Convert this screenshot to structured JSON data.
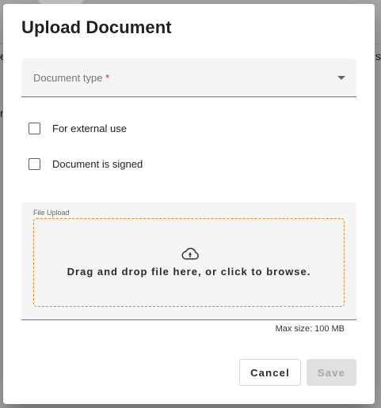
{
  "dialog": {
    "title": "Upload Document"
  },
  "document_type": {
    "label": "Document type",
    "required_marker": "*"
  },
  "checkboxes": [
    {
      "label": "For external use",
      "checked": false
    },
    {
      "label": "Document is signed",
      "checked": false
    }
  ],
  "file_upload": {
    "label": "File Upload",
    "drop_text": "Drag and drop file here, or click to browse.",
    "icon": "cloud-upload-icon",
    "max_size": "Max size: 100 MB"
  },
  "actions": {
    "cancel_label": "Cancel",
    "save_label": "Save",
    "save_enabled": false
  },
  "background": {
    "fragments": [
      "e",
      "s",
      "n"
    ]
  },
  "colors": {
    "drop_zone_border": "#e08a1e",
    "required": "#d32f2f",
    "field_background": "#f5f5f5",
    "disabled_button": "#e0e0e0"
  }
}
